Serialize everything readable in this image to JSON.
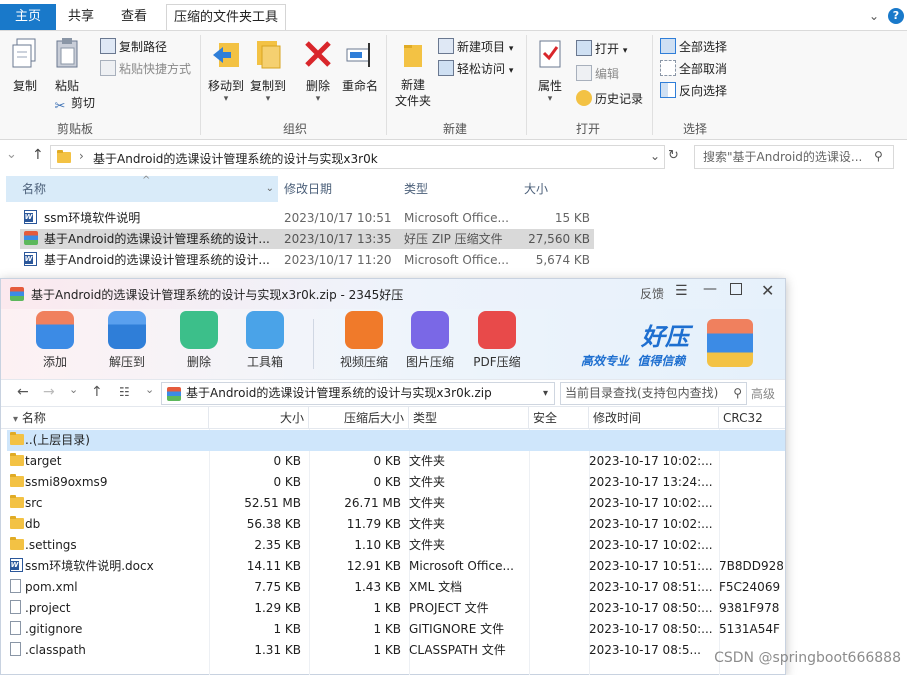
{
  "explorer": {
    "tabs": [
      "主页",
      "共享",
      "查看",
      "压缩的文件夹工具"
    ],
    "ribbon": {
      "copy": "复制",
      "paste": "粘贴",
      "copy_path": "复制路径",
      "paste_shortcut": "粘贴快捷方式",
      "cut": "剪切",
      "group_clipboard": "剪贴板",
      "move_to": "移动到",
      "copy_to": "复制到",
      "delete": "删除",
      "rename": "重命名",
      "group_organize": "组织",
      "new_folder": "新建\n文件夹",
      "new_item": "新建项目",
      "easy_access": "轻松访问",
      "group_new": "新建",
      "properties": "属性",
      "open": "打开",
      "edit": "编辑",
      "history": "历史记录",
      "group_open": "打开",
      "select_all": "全部选择",
      "select_none": "全部取消",
      "invert_selection": "反向选择",
      "group_select": "选择"
    },
    "address": "基于Android的选课设计管理系统的设计与实现x3r0k",
    "search_placeholder": "搜索\"基于Android的选课设...",
    "columns": [
      "名称",
      "修改日期",
      "类型",
      "大小"
    ],
    "files": [
      {
        "name": "ssm环境软件说明",
        "date": "2023/10/17 10:51",
        "type": "Microsoft Office...",
        "size": "15 KB",
        "icon": "word-icon"
      },
      {
        "name": "基于Android的选课设计管理系统的设计...",
        "date": "2023/10/17 13:35",
        "type": "好压 ZIP 压缩文件",
        "size": "27,560 KB",
        "icon": "zip-icon"
      },
      {
        "name": "基于Android的选课设计管理系统的设计...",
        "date": "2023/10/17 11:20",
        "type": "Microsoft Office...",
        "size": "5,674 KB",
        "icon": "word-icon"
      }
    ]
  },
  "zip": {
    "title": "基于Android的选课设计管理系统的设计与实现x3r0k.zip - 2345好压",
    "feedback": "反馈",
    "toolbar": [
      "添加",
      "解压到",
      "删除",
      "工具箱",
      "视频压缩",
      "图片压缩",
      "PDF压缩"
    ],
    "brand": "好压",
    "slogan": "高效专业  值得信赖",
    "path": "基于Android的选课设计管理系统的设计与实现x3r0k.zip",
    "search_placeholder": "当前目录查找(支持包内查找)",
    "advanced": "高级",
    "columns": [
      "名称",
      "大小",
      "压缩后大小",
      "类型",
      "安全",
      "修改时间",
      "CRC32"
    ],
    "rows": [
      {
        "name": "..(上层目录)",
        "size": "",
        "packed": "",
        "type": "",
        "time": "",
        "crc": "",
        "icon": "folder"
      },
      {
        "name": "target",
        "size": "0 KB",
        "packed": "0 KB",
        "type": "文件夹",
        "time": "2023-10-17 10:02:...",
        "crc": "",
        "icon": "folder"
      },
      {
        "name": "ssmi89oxms9",
        "size": "0 KB",
        "packed": "0 KB",
        "type": "文件夹",
        "time": "2023-10-17 13:24:...",
        "crc": "",
        "icon": "folder"
      },
      {
        "name": "src",
        "size": "52.51 MB",
        "packed": "26.71 MB",
        "type": "文件夹",
        "time": "2023-10-17 10:02:...",
        "crc": "",
        "icon": "folder"
      },
      {
        "name": "db",
        "size": "56.38 KB",
        "packed": "11.79 KB",
        "type": "文件夹",
        "time": "2023-10-17 10:02:...",
        "crc": "",
        "icon": "folder"
      },
      {
        "name": ".settings",
        "size": "2.35 KB",
        "packed": "1.10 KB",
        "type": "文件夹",
        "time": "2023-10-17 10:02:...",
        "crc": "",
        "icon": "folder"
      },
      {
        "name": "ssm环境软件说明.docx",
        "size": "14.11 KB",
        "packed": "12.91 KB",
        "type": "Microsoft Office...",
        "time": "2023-10-17 10:51:...",
        "crc": "7B8DD928",
        "icon": "word"
      },
      {
        "name": "pom.xml",
        "size": "7.75 KB",
        "packed": "1.43 KB",
        "type": "XML 文档",
        "time": "2023-10-17 08:51:...",
        "crc": "F5C24069",
        "icon": "doc"
      },
      {
        "name": ".project",
        "size": "1.29 KB",
        "packed": "1 KB",
        "type": "PROJECT 文件",
        "time": "2023-10-17 08:50:...",
        "crc": "9381F978",
        "icon": "doc"
      },
      {
        "name": ".gitignore",
        "size": "1 KB",
        "packed": "1 KB",
        "type": "GITIGNORE 文件",
        "time": "2023-10-17 08:50:...",
        "crc": "5131A54F",
        "icon": "doc"
      },
      {
        "name": ".classpath",
        "size": "1.31 KB",
        "packed": "1 KB",
        "type": "CLASSPATH 文件",
        "time": "2023-10-17 08:5...",
        "crc": "",
        "icon": "doc"
      }
    ]
  },
  "watermark": "CSDN @springboot666888"
}
